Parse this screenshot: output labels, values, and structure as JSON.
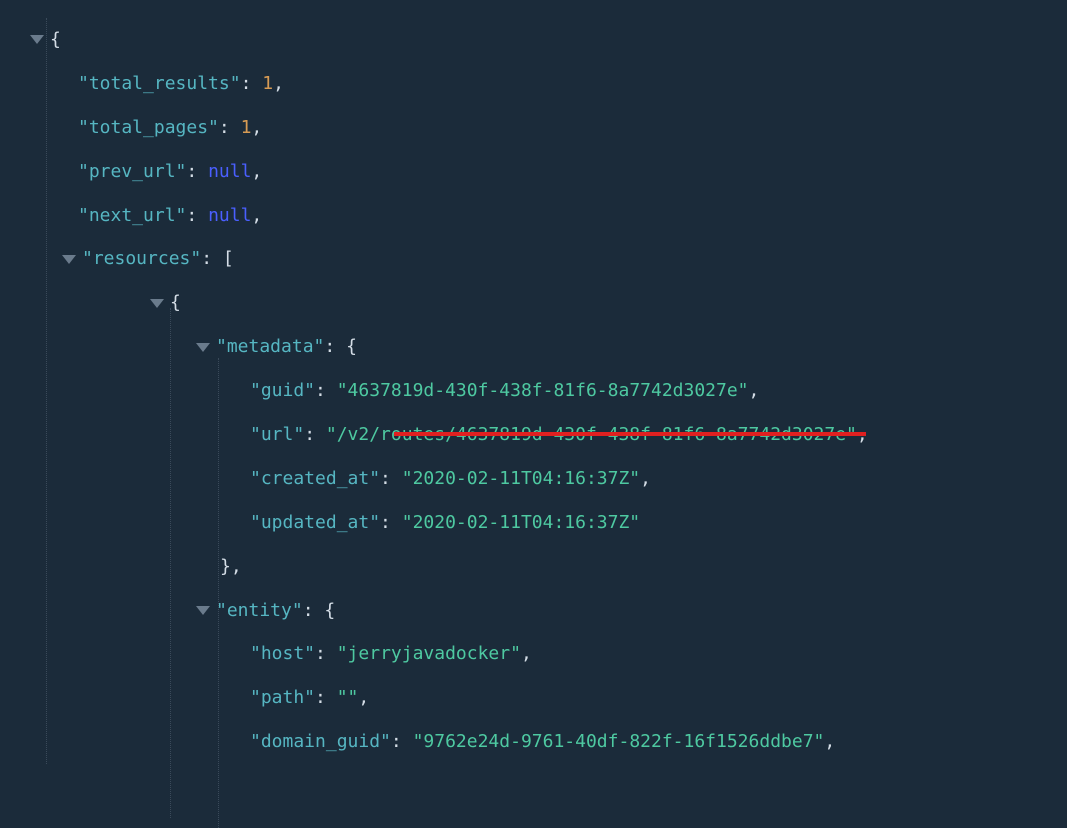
{
  "root": {
    "open_brace": "{",
    "close_brace": "}",
    "comma": ",",
    "colon_sp": ": ",
    "open_bracket": "[",
    "close_bracket": "]"
  },
  "pairs": {
    "total_results": {
      "key": "\"total_results\"",
      "value": "1"
    },
    "total_pages": {
      "key": "\"total_pages\"",
      "value": "1"
    },
    "prev_url": {
      "key": "\"prev_url\"",
      "value": "null"
    },
    "next_url": {
      "key": "\"next_url\"",
      "value": "null"
    },
    "resources": {
      "key": "\"resources\""
    },
    "metadata": {
      "key": "\"metadata\""
    },
    "guid": {
      "key": "\"guid\"",
      "value": "\"4637819d-430f-438f-81f6-8a7742d3027e\""
    },
    "url": {
      "key": "\"url\"",
      "value": "\"/v2/routes/4637819d-430f-438f-81f6-8a7742d3027e\""
    },
    "created_at": {
      "key": "\"created_at\"",
      "value": "\"2020-02-11T04:16:37Z\""
    },
    "updated_at": {
      "key": "\"updated_at\"",
      "value": "\"2020-02-11T04:16:37Z\""
    },
    "entity": {
      "key": "\"entity\""
    },
    "host": {
      "key": "\"host\"",
      "value": "\"jerryjavadocker\""
    },
    "path": {
      "key": "\"path\"",
      "value": "\"\""
    },
    "domain_guid": {
      "key": "\"domain_guid\"",
      "value": "\"9762e24d-9761-40df-822f-16f1526ddbe7\""
    }
  }
}
